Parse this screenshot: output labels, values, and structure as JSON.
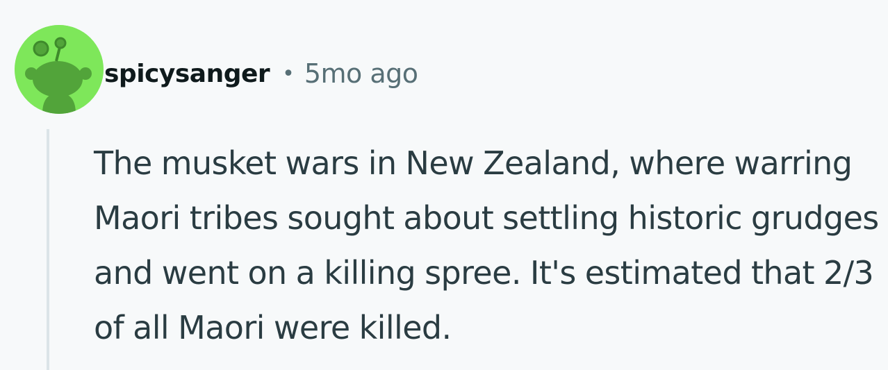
{
  "comment": {
    "author": {
      "username": "spicysanger",
      "avatar_icon": "snoo-avatar-icon",
      "avatar_color": "#7ee75a"
    },
    "separator": "•",
    "timestamp": "5mo ago",
    "body": "The musket wars in New Zealand, where warring Maori tribes sought about settling historic grudges and went on a killing spree. It's estimated that 2/3 of all Maori were killed."
  },
  "colors": {
    "background": "#f7f9fa",
    "text": "#2a3c42",
    "username": "#0f1a1c",
    "meta": "#576f76",
    "thread_line": "#dbe4e8"
  }
}
